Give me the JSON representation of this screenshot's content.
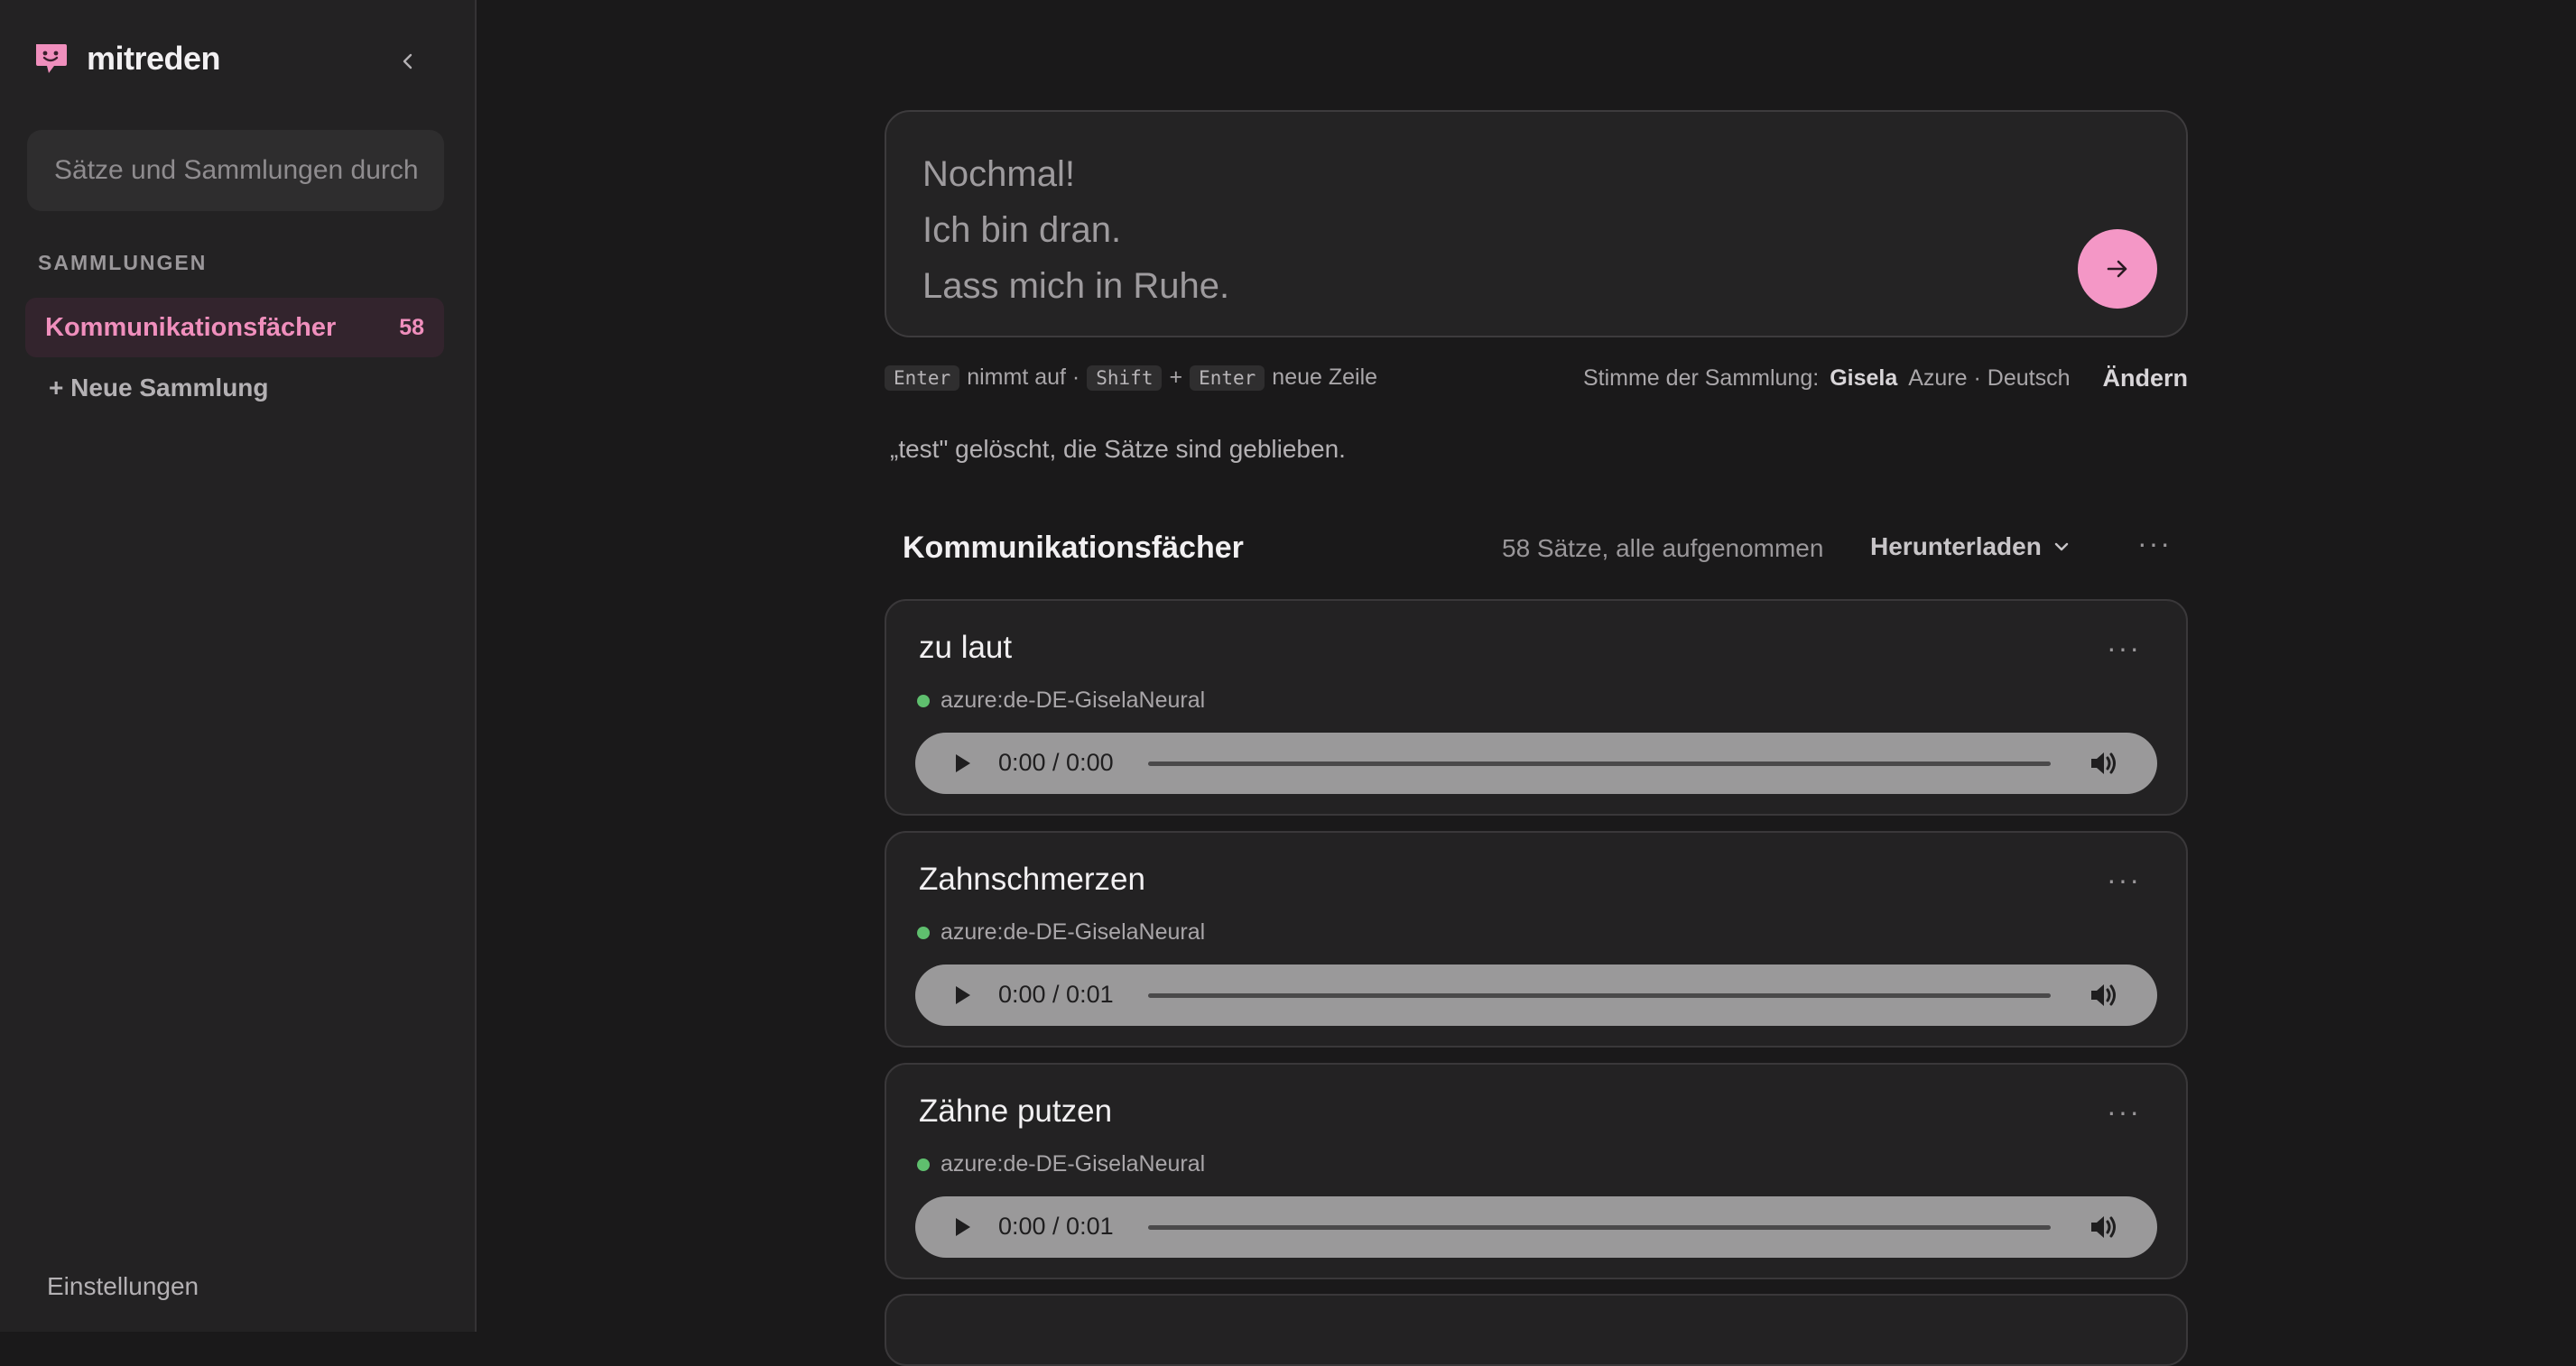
{
  "app": {
    "name": "mitreden",
    "accent": "#f497c6"
  },
  "sidebar": {
    "search_placeholder": "Sätze und Sammlungen durchsuchen",
    "section_label": "SAMMLUNGEN",
    "collections": [
      {
        "name": "Kommunikationsfächer",
        "count": "58",
        "active": true
      }
    ],
    "new_collection_label": "+ Neue Sammlung",
    "settings_label": "Einstellungen"
  },
  "composer": {
    "lines": [
      "Nochmal!",
      "Ich bin dran.",
      "Lass mich in Ruhe."
    ]
  },
  "hints": {
    "key_enter": "Enter",
    "text_record": "nimmt auf ·",
    "key_shift": "Shift",
    "plus": "+",
    "key_enter2": "Enter",
    "text_newline": "neue Zeile",
    "voice_label": "Stimme der Sammlung:",
    "voice_name": "Gisela",
    "voice_details": "Azure · Deutsch",
    "change_label": "Ändern"
  },
  "notice": "„test\" gelöscht, die Sätze sind geblieben.",
  "collection": {
    "title": "Kommunikationsfächer",
    "meta": "58 Sätze, alle aufgenommen",
    "download_label": "Herunterladen",
    "more_label": "···"
  },
  "phrases": [
    {
      "text": "zu laut",
      "voice": "azure:de-DE-GiselaNeural",
      "time": "0:00 / 0:00"
    },
    {
      "text": "Zahnschmerzen",
      "voice": "azure:de-DE-GiselaNeural",
      "time": "0:00 / 0:01"
    },
    {
      "text": "Zähne putzen",
      "voice": "azure:de-DE-GiselaNeural",
      "time": "0:00 / 0:01"
    }
  ]
}
